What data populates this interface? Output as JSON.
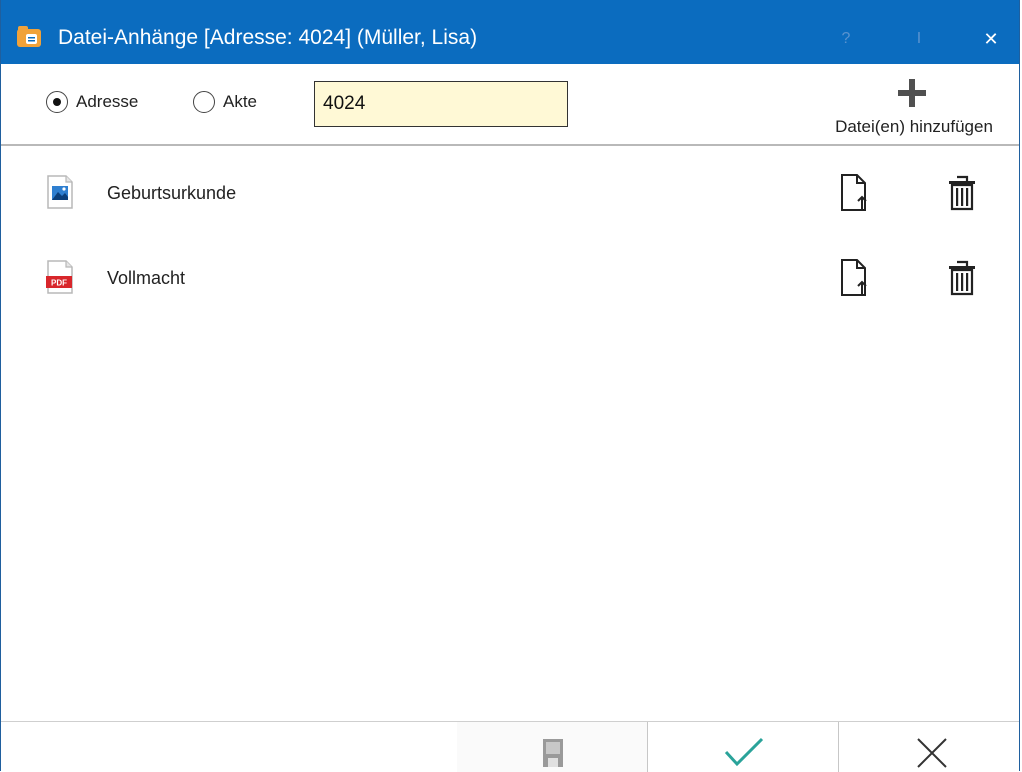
{
  "window": {
    "title": "Datei-Anhänge [Adresse: 4024] (Müller, Lisa)",
    "help_glyph": "?",
    "cursor_glyph": "I",
    "close_glyph": "✕"
  },
  "toolbar": {
    "radio_adresse_label": "Adresse",
    "radio_akte_label": "Akte",
    "selected": "Adresse",
    "number_value": "4024",
    "add_files_label": "Datei(en) hinzufügen"
  },
  "files": [
    {
      "name": "Geburtsurkunde",
      "icon": "image-file-icon"
    },
    {
      "name": "Vollmacht",
      "icon": "pdf-file-icon",
      "badge": "PDF"
    }
  ],
  "footer": {
    "buttons": [
      "save-icon",
      "checkmark-icon",
      "cancel-x-icon"
    ]
  },
  "colors": {
    "titlebar": "#0b6cbf",
    "input_bg": "#fff9d6",
    "ok_accent": "#2aa39a"
  }
}
